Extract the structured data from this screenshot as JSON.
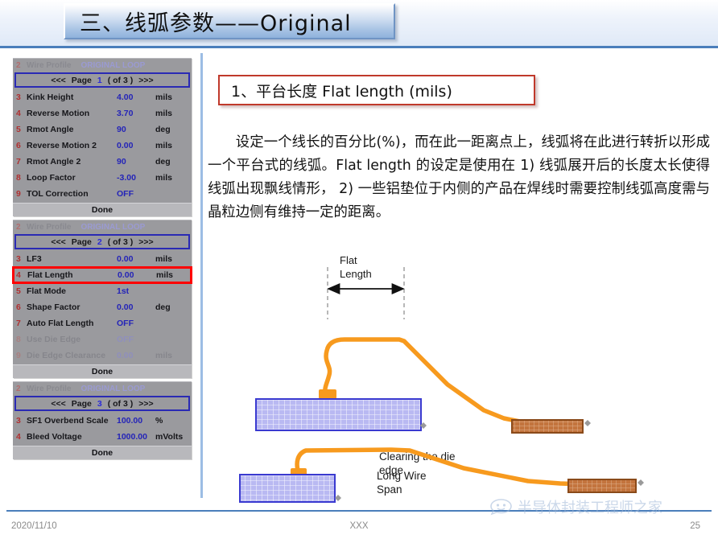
{
  "slide": {
    "title": "三、线弧参数——Original",
    "heading": "1、平台长度 Flat length (mils)",
    "body": "设定一个线长的百分比(%)，而在此一距离点上，线弧将在此进行转折以形成一个平台式的线弧。Flat length 的设定是使用在 1) 线弧展开后的长度太长使得线弧出现飘线情形， 2) 一些铝垫位于内侧的产品在焊线时需要控制线弧高度需与晶粒边侧有维持一定的距离。"
  },
  "colors": {
    "accent_blue": "#4a7ebb",
    "panel_grey": "#9a9a9e",
    "highlight_red": "#ff0000",
    "value_blue": "#2424b8",
    "index_red": "#b03030",
    "wire_orange": "#f79a1e",
    "die_blue": "#9a9ae8",
    "lead_brown": "#b5651d"
  },
  "panels": [
    {
      "header": {
        "index": "2",
        "label": "Wire Profile",
        "value": "ORIGINAL LOOP"
      },
      "nav": {
        "prev": "<<<",
        "label": "Page",
        "page": "1",
        "of": "( of 3 )",
        "next": ">>>"
      },
      "rows": [
        {
          "index": "3",
          "name": "Kink Height",
          "value": "4.00",
          "unit": "mils",
          "disabled": false,
          "highlighted": false
        },
        {
          "index": "4",
          "name": "Reverse Motion",
          "value": "3.70",
          "unit": "mils",
          "disabled": false,
          "highlighted": false
        },
        {
          "index": "5",
          "name": "Rmot Angle",
          "value": "90",
          "unit": "deg",
          "disabled": false,
          "highlighted": false
        },
        {
          "index": "6",
          "name": "Reverse Motion 2",
          "value": "0.00",
          "unit": "mils",
          "disabled": false,
          "highlighted": false
        },
        {
          "index": "7",
          "name": "Rmot Angle 2",
          "value": "90",
          "unit": "deg",
          "disabled": false,
          "highlighted": false
        },
        {
          "index": "8",
          "name": "Loop Factor",
          "value": "-3.00",
          "unit": "mils",
          "disabled": false,
          "highlighted": false
        },
        {
          "index": "9",
          "name": "TOL Correction",
          "value": "OFF",
          "unit": "",
          "disabled": false,
          "highlighted": false
        }
      ],
      "done": "Done"
    },
    {
      "header": {
        "index": "2",
        "label": "Wire Profile",
        "value": "ORIGINAL LOOP"
      },
      "nav": {
        "prev": "<<<",
        "label": "Page",
        "page": "2",
        "of": "( of 3 )",
        "next": ">>>"
      },
      "rows": [
        {
          "index": "3",
          "name": "LF3",
          "value": "0.00",
          "unit": "mils",
          "disabled": false,
          "highlighted": false
        },
        {
          "index": "4",
          "name": "Flat Length",
          "value": "0.00",
          "unit": "mils",
          "disabled": false,
          "highlighted": true
        },
        {
          "index": "5",
          "name": "Flat Mode",
          "value": "1st",
          "unit": "",
          "disabled": false,
          "highlighted": false
        },
        {
          "index": "6",
          "name": "Shape Factor",
          "value": "0.00",
          "unit": "deg",
          "disabled": false,
          "highlighted": false
        },
        {
          "index": "7",
          "name": "Auto Flat Length",
          "value": "OFF",
          "unit": "",
          "disabled": false,
          "highlighted": false
        },
        {
          "index": "8",
          "name": "Use Die Edge",
          "value": "OFF",
          "unit": "",
          "disabled": true,
          "highlighted": false
        },
        {
          "index": "9",
          "name": "Die Edge Clearance",
          "value": "0.00",
          "unit": "mils",
          "disabled": true,
          "highlighted": false
        }
      ],
      "done": "Done"
    },
    {
      "header": {
        "index": "2",
        "label": "Wire Profile",
        "value": "ORIGINAL LOOP"
      },
      "nav": {
        "prev": "<<<",
        "label": "Page",
        "page": "3",
        "of": "( of 3 )",
        "next": ">>>"
      },
      "rows": [
        {
          "index": "3",
          "name": "SF1 Overbend Scale",
          "value": "100.00",
          "unit": "%",
          "disabled": false,
          "highlighted": false
        },
        {
          "index": "4",
          "name": "Bleed Voltage",
          "value": "1000.00",
          "unit": "mVolts",
          "disabled": false,
          "highlighted": false
        }
      ],
      "done": "Done"
    }
  ],
  "diagram": {
    "dimension_label_line1": "Flat",
    "dimension_label_line2": "Length",
    "caption_upper_line1": "Clearing the die",
    "caption_upper_line2": "edge",
    "caption_lower_line1": "Long Wire",
    "caption_lower_line2": "Span"
  },
  "footer": {
    "date": "2020/11/10",
    "center": "XXX",
    "page_number": "25",
    "watermark": "半导体封装工程师之家"
  }
}
